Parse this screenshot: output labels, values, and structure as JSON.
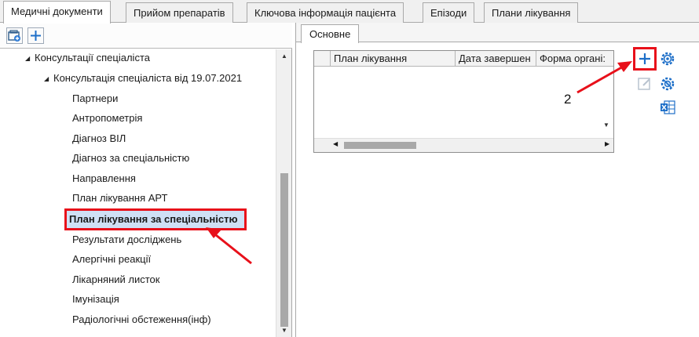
{
  "tabs": [
    {
      "label": "Медичні документи",
      "active": true
    },
    {
      "label": "Прийом препаратів",
      "active": false
    },
    {
      "label": "Ключова інформація пацієнта",
      "active": false
    },
    {
      "label": "Епізоди",
      "active": false
    },
    {
      "label": "Плани лікування",
      "active": false
    }
  ],
  "left_toolbar": {
    "icons": [
      "add-document-icon",
      "plus-icon"
    ]
  },
  "tree": {
    "root": {
      "label": "Консультації спеціаліста",
      "expanded": true
    },
    "child": {
      "label": "Консультація спеціаліста від 19.07.2021",
      "expanded": true
    },
    "items": [
      "Партнери",
      "Антропометрія",
      "Діагноз ВІЛ",
      "Діагноз за спеціальністю",
      "Направлення",
      "План лікування АРТ",
      "План лікування за спеціальністю",
      "Результати досліджень",
      "Алергічні реакції",
      "Лікарняний листок",
      "Імунізація",
      "Радіологічні обстеження(інф)"
    ],
    "selected_index": 6
  },
  "right": {
    "inner_tab": "Основне",
    "grid": {
      "columns": [
        "План лікування",
        "Дата завершен",
        "Форма органі:"
      ],
      "rows": []
    },
    "buttons": {
      "add_icon": "plus-icon",
      "settings_icon": "gear-icon",
      "edit_icon": "edit-icon",
      "settings2_icon": "gear-blue-icon",
      "excel_icon": "excel-icon"
    }
  },
  "annotations": {
    "step_number": "2",
    "highlight_color": "#e8101a"
  }
}
